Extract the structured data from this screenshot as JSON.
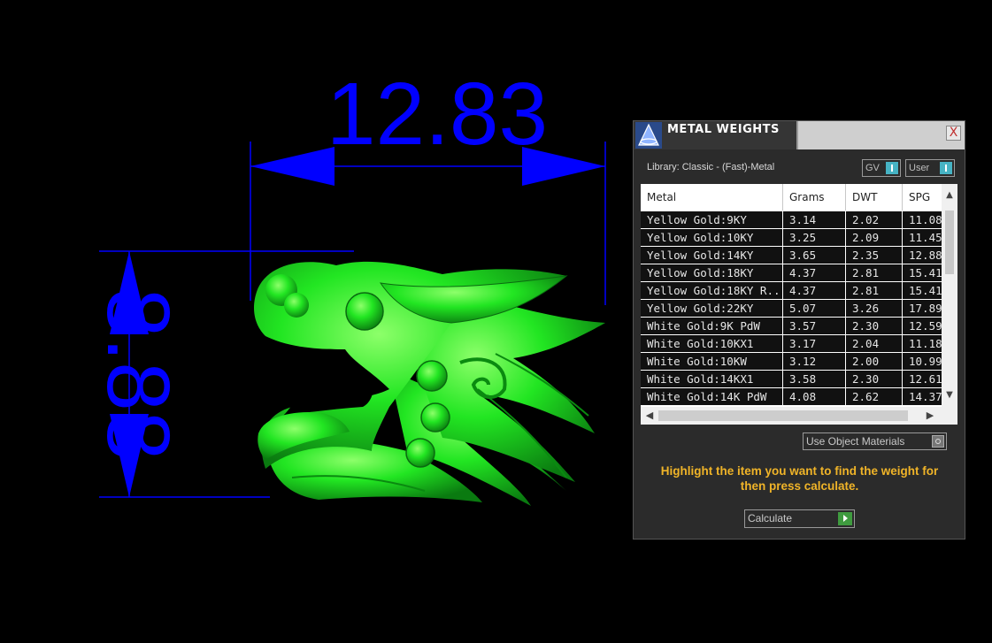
{
  "viewport": {
    "width_dimension": "12.83",
    "height_dimension": "8.88",
    "dimension_color": "#0000ff",
    "model_color": "#22ee22",
    "model_name": "dragon-head-model"
  },
  "panel": {
    "title": "METAL WEIGHTS",
    "close_label": "X",
    "library_label": "Library: Classic - (Fast)-Metal",
    "gv_label": "GV",
    "user_label": "User",
    "table": {
      "columns": [
        "Metal",
        "Grams",
        "DWT",
        "SPG"
      ],
      "rows": [
        [
          "Yellow Gold:9KY",
          "3.14",
          "2.02",
          "11.08"
        ],
        [
          "Yellow Gold:10KY",
          "3.25",
          "2.09",
          "11.45"
        ],
        [
          "Yellow Gold:14KY",
          "3.65",
          "2.35",
          "12.88"
        ],
        [
          "Yellow Gold:18KY",
          "4.37",
          "2.81",
          "15.41"
        ],
        [
          "Yellow Gold:18KY R...",
          "4.37",
          "2.81",
          "15.41"
        ],
        [
          "Yellow Gold:22KY",
          "5.07",
          "3.26",
          "17.89"
        ],
        [
          "White Gold:9K PdW",
          "3.57",
          "2.30",
          "12.59"
        ],
        [
          "White Gold:10KX1",
          "3.17",
          "2.04",
          "11.18"
        ],
        [
          "White Gold:10KW",
          "3.12",
          "2.00",
          "10.99"
        ],
        [
          "White Gold:14KX1",
          "3.58",
          "2.30",
          "12.61"
        ],
        [
          "White Gold:14K PdW",
          "4.08",
          "2.62",
          "14.37"
        ]
      ]
    },
    "use_object_materials_label": "Use Object Materials",
    "hint_text": "Highlight the item you want to find the weight for then press calculate.",
    "calculate_label": "Calculate",
    "accent_color": "#f0b428"
  }
}
